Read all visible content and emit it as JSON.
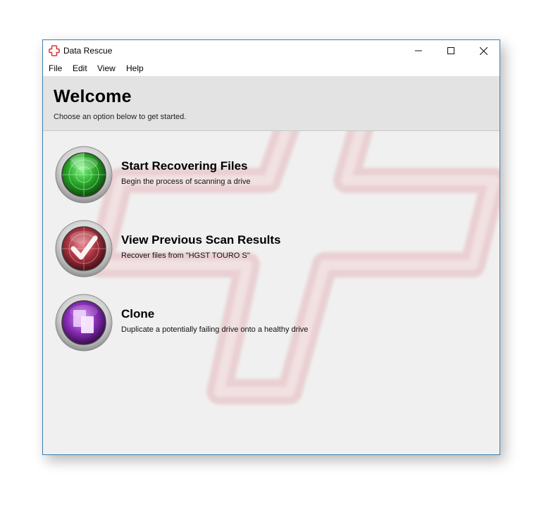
{
  "window": {
    "title": "Data Rescue",
    "app_icon": "data-rescue-cross-icon",
    "controls": {
      "minimize_icon": "minimize-icon",
      "maximize_icon": "maximize-icon",
      "close_icon": "close-icon"
    }
  },
  "menu": {
    "items": [
      {
        "label": "File"
      },
      {
        "label": "Edit"
      },
      {
        "label": "View"
      },
      {
        "label": "Help"
      }
    ]
  },
  "header": {
    "title": "Welcome",
    "subtitle": "Choose an option below to get started."
  },
  "options": [
    {
      "title": "Start Recovering Files",
      "description": "Begin the process of scanning a drive",
      "icon": "green-radar-icon",
      "color": "#2aa82a"
    },
    {
      "title": "View Previous Scan Results",
      "description": "Recover files from \"HGST TOURO S\"",
      "icon": "checkmark-radar-icon",
      "color": "#a8323e"
    },
    {
      "title": "Clone",
      "description": "Duplicate a potentially failing drive onto a healthy drive",
      "icon": "clone-documents-icon",
      "color": "#8a2fb8"
    }
  ],
  "colors": {
    "window_border": "#3c7fb1",
    "header_bg": "#e3e3e3",
    "content_bg": "#f0f0f0",
    "brand_red": "#d9363e"
  }
}
